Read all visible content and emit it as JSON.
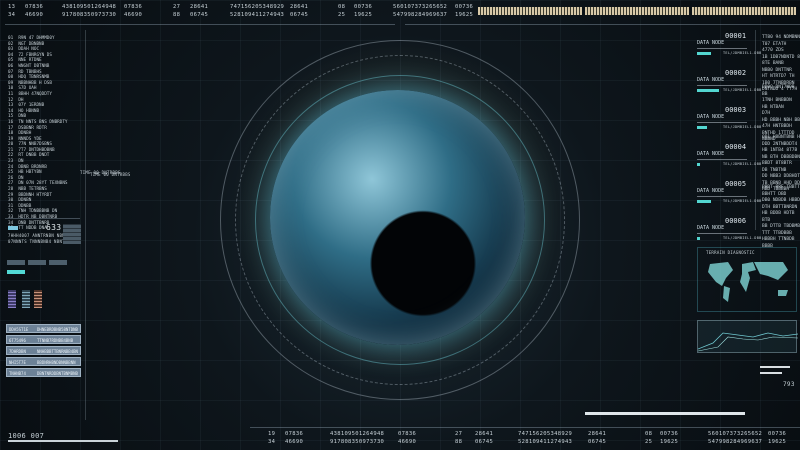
{
  "top_rows": [
    [
      "13",
      "07836",
      "438109501264948",
      "07836",
      "27",
      "28641",
      "747156205348929",
      "28641",
      "08",
      "00736",
      "560107373265652",
      "00736"
    ],
    [
      "34",
      "46690",
      "917808350973730",
      "46690",
      "88",
      "06745",
      "528109411274943",
      "06745",
      "25",
      "19625",
      "547998284969637",
      "19625"
    ]
  ],
  "bottom_rows": [
    [
      "19",
      "07836",
      "438109501264948",
      "07836",
      "27",
      "28641",
      "747156205348929",
      "28641",
      "08",
      "00736",
      "560107373265652",
      "00736"
    ],
    [
      "34",
      "46690",
      "917808350973730",
      "46690",
      "88",
      "06745",
      "528109411274943",
      "06745",
      "25",
      "19625",
      "547998284969637",
      "19625"
    ]
  ],
  "left_list": "01  R9N 47 DHMMD0Y\n02  NGT DBNBNB\n03  DDAH NOC\n04  72 FBNRGYN DS\n05  NNE RTDNE\n06  WNGNT DBTNNB\n07  RD TBNBHS\n08  HDQ TBNRSNMB\n09  NBBNHBB H DSB\n10  S7D UAH\n11  8BHH 47NQDDTY\n12  DH\n13  07Y 1ERDNB\n14  HO HBNNB\n15  DNB\n16  TN NNTS BNS DNBRDTY\n17  DSBBNR RDTR\n18  DDNBH\n19  NNNDS YDE\n20  77N NNB7DSBNS\n21  7T7 DNTDHBDBNB\n22  RT DNBB DNDT\n23  DN\n24  DBNB BRDNRB\n25  HB HBTYBN\n26  DN\n27  DN 07N 28YT TEXNBNS\n28  NBB TETRBNS\n29  BBDNNH HTYRDT\n30  DDNBN\n31  DDNBB\n32  TNH TDNBBBNB DN\n33  HDTR NB DBNTNRB\n34  DNB DNTTBNRB\n35  TT NDDB DNA",
  "left_side_label": "TIME 00 DNTRBBS",
  "left_stats": {
    "value": "633",
    "line1": "7HHH4007 ANNTRNBN NBNNTB4BN",
    "line2": "07NNNTS TNNNBNB4 NBNTBHNTY"
  },
  "left_boxes": [
    "DDA5ST1E",
    "6T75496",
    "7DHRDBN",
    "NHI5T7E",
    "TNHNB74"
  ],
  "left_box_values": [
    "DHNEBRDBNB58NTDNB",
    "TTNNB7RDNBB4BNB",
    "NNHBBBTTBNRNBB4BN",
    "BBDNRHBNDBNNBBNN",
    "DBNTNRDDBNTBNMBNB"
  ],
  "bottom_left_value": "1006 007",
  "right_panel": {
    "node_label": "DATA NODE",
    "nodes": [
      "00001",
      "00002",
      "00003",
      "00004",
      "00005",
      "00006"
    ],
    "node_caption": "TEL/JDMBIEL1.DBB",
    "text_blocks": [
      "TT80 94 NDMBNNB\nT07 ETATH\n4770 ZDS\n1B 1DB7NDNTD 8\n8TE BANB\nNBB0 DNTTNR\nHT NTRTD7 TH\n1B0 7TNBDRBN\nDNTNDD 4 TT7H",
      "DB00 DNT7NDB\nBB\n1TNH BNBBDN\nHB NTBAN\nD7H\nHD BBBH NBH BB\n47H HNTBBDH\nBNTHD 1TTTDD\nNBBND",
      "0D1 H8BNTBNB HD\nDDD 2NTNBDDT4\nHB 1NTB4 8T7B\nNB BTH DBBBDBN\nBBDT 8T8BTR\nDB TNBTNB\nDD NBB3 DDBHDT\nTB BBNB HHD DDT\nHBD TBBBBH",
      "BBDT BBE TBBTT\nBBHTT DBD\nDB0 NDBDB HBBD\nDTH BBTTBNRDN\nHB BDDB HDTB\nBTB\nBB DTTB TBDBMBD\nTTT TTBDBBB\nHBBBH TTNBDB\nBBBB"
    ],
    "terrain_title": "TERRAIN DIAGNOSTIC",
    "readout": "793"
  },
  "center_label": "TIME 00 DNTRBBS",
  "colors": {
    "accent": "#53d6d0",
    "globe": "#2f6d86",
    "gold": "#d8c9a8"
  }
}
